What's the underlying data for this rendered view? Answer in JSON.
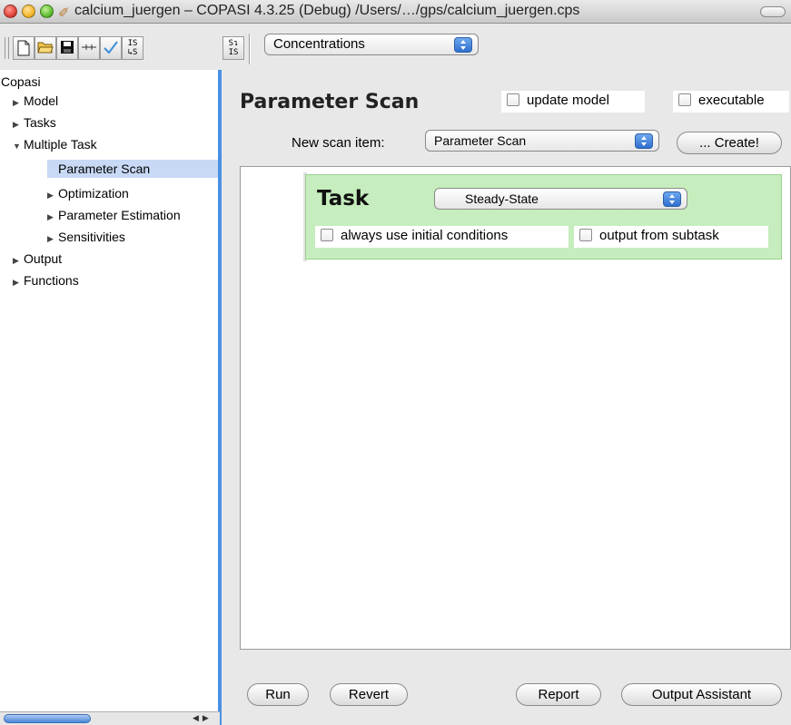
{
  "window": {
    "title": "calcium_juergen – COPASI 4.3.25 (Debug) /Users/…/gps/calcium_juergen.cps"
  },
  "toolbar": {
    "buttons": [
      {
        "name": "new-file",
        "icon": "document-icon"
      },
      {
        "name": "open-file",
        "icon": "folder-open-icon"
      },
      {
        "name": "save-file",
        "icon": "floppy-disk-icon"
      },
      {
        "name": "slider",
        "icon": "slider-icon"
      },
      {
        "name": "check-model",
        "icon": "checkmark-icon"
      },
      {
        "name": "import-sbml",
        "label": "IS\n↳S"
      },
      {
        "name": "export-sbml",
        "label": "S↴\nIS"
      }
    ],
    "unit_select": "Concentrations"
  },
  "tree": {
    "root": "Copasi",
    "items": [
      {
        "label": "Model",
        "expanded": false
      },
      {
        "label": "Tasks",
        "expanded": false
      },
      {
        "label": "Multiple Task",
        "expanded": true
      },
      {
        "label": "Parameter Scan",
        "selected": true
      },
      {
        "label": "Optimization",
        "expanded": false
      },
      {
        "label": "Parameter Estimation",
        "expanded": false
      },
      {
        "label": "Sensitivities",
        "expanded": false
      },
      {
        "label": "Output",
        "expanded": false
      },
      {
        "label": "Functions",
        "expanded": false
      }
    ]
  },
  "main": {
    "title": "Parameter Scan",
    "update_model_label": "update model",
    "executable_label": "executable",
    "new_scan_label": "New scan item:",
    "new_scan_value": "Parameter Scan",
    "create_label": "... Create!",
    "task": {
      "label": "Task",
      "type": "Steady-State",
      "initial_conditions_label": "always use initial conditions",
      "output_subtask_label": "output from subtask"
    },
    "buttons": {
      "run": "Run",
      "revert": "Revert",
      "report": "Report",
      "output_assistant": "Output Assistant"
    }
  },
  "colors": {
    "selection": "#c8d9f5",
    "task_panel": "#c6edbd",
    "accent": "#4a90e2"
  }
}
